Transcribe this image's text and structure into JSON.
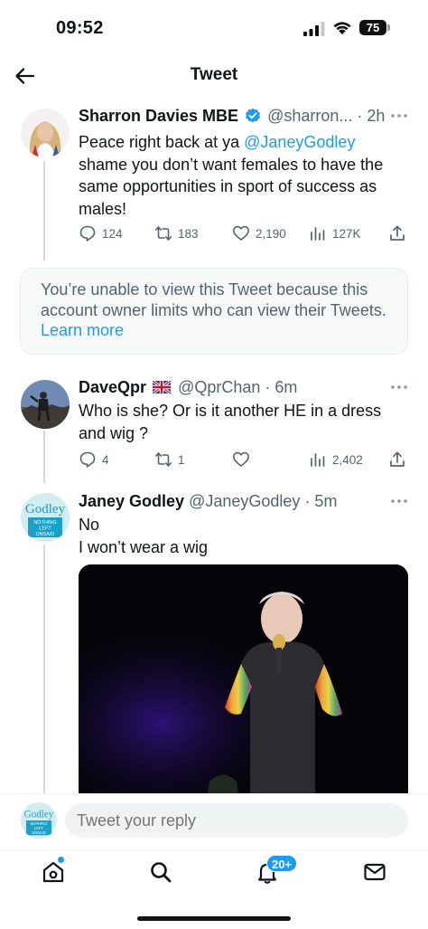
{
  "status_bar": {
    "time": "09:52",
    "battery": "75",
    "icons": [
      "signal-icon",
      "wifi-icon",
      "battery-icon"
    ]
  },
  "header": {
    "title": "Tweet",
    "back_icon": "arrow-left-icon"
  },
  "tweets": [
    {
      "name": "Sharron Davies MBE",
      "verified": true,
      "handle": "@sharron...",
      "time": "· 2h",
      "text_before": "Peace right back at ya ",
      "mention": "@JaneyGodley",
      "text_after": " shame you don’t want females to have the same opportunities in sport of success as males!",
      "replies": "124",
      "retweets": "183",
      "likes": "2,190",
      "views": "127K"
    },
    {
      "name": "DaveQpr",
      "flag": "uk-flag-icon",
      "handle": "@QprChan",
      "time": "· 6m",
      "text": "Who is she? Or is it another HE in a dress and wig ?",
      "replies": "4",
      "retweets": "1",
      "likes": "",
      "views": "2,402"
    },
    {
      "name": "Janey Godley",
      "handle": "@JaneyGodley",
      "time": "· 5m",
      "line1": "No",
      "line2": "I won’t wear a wig"
    }
  ],
  "restricted": {
    "message": "You’re unable to view this Tweet because this account owner limits who can view their Tweets.",
    "link": "Learn more"
  },
  "avatar_text": {
    "name": "Godley",
    "sub1": "NOTHING",
    "sub2": "LEFT",
    "sub3": "UNSAID"
  },
  "reply": {
    "placeholder": "Tweet your reply"
  },
  "nav": {
    "notification_badge": "20+",
    "items": [
      "home-icon",
      "search-icon",
      "notifications-icon",
      "messages-icon"
    ]
  },
  "colors": {
    "accent": "#1d9bf0",
    "text": "#0f1419",
    "secondary": "#536471"
  }
}
